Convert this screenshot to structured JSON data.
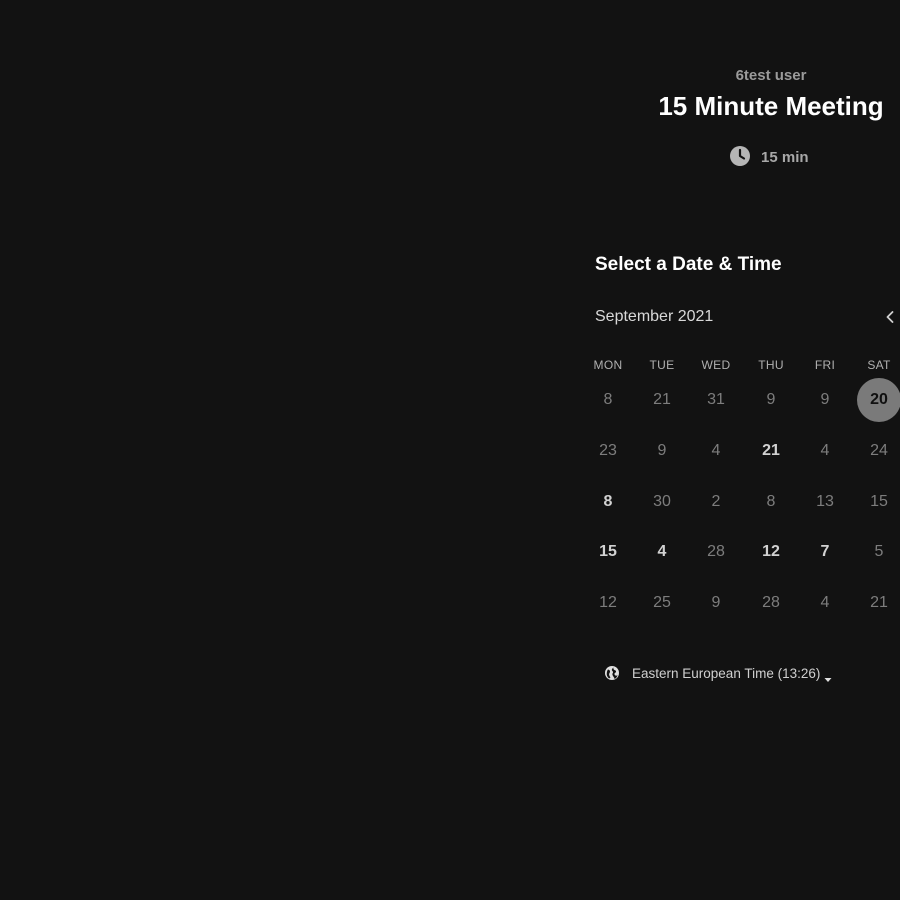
{
  "event": {
    "host": "6test user",
    "title": "15 Minute Meeting",
    "duration": "15 min",
    "duration_icon": "clock-icon"
  },
  "booking": {
    "section_title": "Select a Date & Time",
    "month": "September 2021",
    "prev_icon": "chevron-left-icon",
    "weekdays": [
      "MON",
      "TUE",
      "WED",
      "THU",
      "FRI",
      "SAT"
    ],
    "weeks": [
      [
        {
          "label": "8",
          "state": "muted"
        },
        {
          "label": "21",
          "state": "muted"
        },
        {
          "label": "31",
          "state": "muted"
        },
        {
          "label": "9",
          "state": "muted"
        },
        {
          "label": "9",
          "state": "muted"
        },
        {
          "label": "20",
          "state": "selected"
        }
      ],
      [
        {
          "label": "23",
          "state": "muted"
        },
        {
          "label": "9",
          "state": "muted"
        },
        {
          "label": "4",
          "state": "muted"
        },
        {
          "label": "21",
          "state": "available"
        },
        {
          "label": "4",
          "state": "muted"
        },
        {
          "label": "24",
          "state": "muted"
        }
      ],
      [
        {
          "label": "8",
          "state": "available"
        },
        {
          "label": "30",
          "state": "muted"
        },
        {
          "label": "2",
          "state": "muted"
        },
        {
          "label": "8",
          "state": "muted"
        },
        {
          "label": "13",
          "state": "muted"
        },
        {
          "label": "15",
          "state": "muted"
        }
      ],
      [
        {
          "label": "15",
          "state": "available"
        },
        {
          "label": "4",
          "state": "available"
        },
        {
          "label": "28",
          "state": "muted"
        },
        {
          "label": "12",
          "state": "available"
        },
        {
          "label": "7",
          "state": "available"
        },
        {
          "label": "5",
          "state": "muted"
        }
      ],
      [
        {
          "label": "12",
          "state": "muted"
        },
        {
          "label": "25",
          "state": "muted"
        },
        {
          "label": "9",
          "state": "muted"
        },
        {
          "label": "28",
          "state": "muted"
        },
        {
          "label": "4",
          "state": "muted"
        },
        {
          "label": "21",
          "state": "muted"
        }
      ]
    ],
    "timezone": "Eastern European Time (13:26)",
    "timezone_icon": "globe-icon",
    "timezone_caret_icon": "caret-down-icon"
  },
  "colors": {
    "background": "#121212",
    "selected_day": "#7a7a7a",
    "muted_day": "#7d7d7d",
    "available_day": "#d2d2d2"
  }
}
